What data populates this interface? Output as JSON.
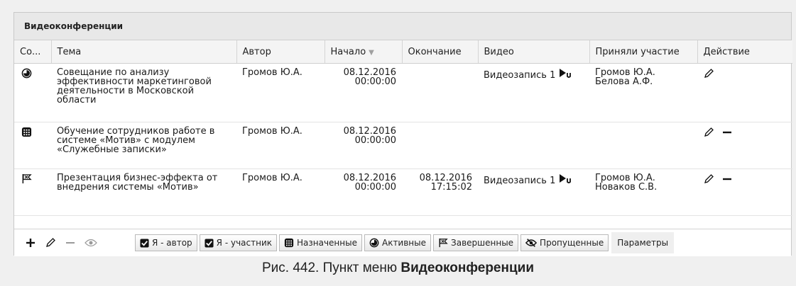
{
  "panel": {
    "title": "Видеоконференции"
  },
  "columns": {
    "status": "Со...",
    "topic": "Тема",
    "author": "Автор",
    "start": "Начало",
    "end": "Окончание",
    "video": "Видео",
    "participants": "Приняли участие",
    "action": "Действие"
  },
  "rows": [
    {
      "status_icon": "active-status-icon",
      "topic": "Совещание по анализу эффективности маркетинговой деятельности в Московской области",
      "author": "Громов Ю.А.",
      "start_date": "08.12.2016",
      "start_time": "00:00:00",
      "end_date": "",
      "end_time": "",
      "video": "Видеозапись 1",
      "participants": [
        "Громов Ю.А.",
        "Белова А.Ф."
      ]
    },
    {
      "status_icon": "scheduled-status-icon",
      "topic": "Обучение сотрудников работе в системе «Мотив» с модулем «Служебные записки»",
      "author": "Громов Ю.А.",
      "start_date": "08.12.2016",
      "start_time": "00:00:00",
      "end_date": "",
      "end_time": "",
      "video": "",
      "participants": []
    },
    {
      "status_icon": "finished-flag-icon",
      "topic": "Презентация бизнес-эффекта от внедрения системы «Мотив»",
      "author": "Громов Ю.А.",
      "start_date": "08.12.2016",
      "start_time": "00:00:00",
      "end_date": "08.12.2016",
      "end_time": "17:15:02",
      "video": "Видеозапись 1",
      "participants": [
        "Громов Ю.А.",
        "Новаков С.В."
      ]
    }
  ],
  "filters": {
    "author": "Я - автор",
    "participant": "Я - участник",
    "assigned": "Назначенные",
    "active": "Активные",
    "finished": "Завершенные",
    "missed": "Пропущенные",
    "params": "Параметры"
  },
  "caption": {
    "prefix": "Рис. 442. Пункт меню ",
    "bold": "Видеоконференции"
  }
}
